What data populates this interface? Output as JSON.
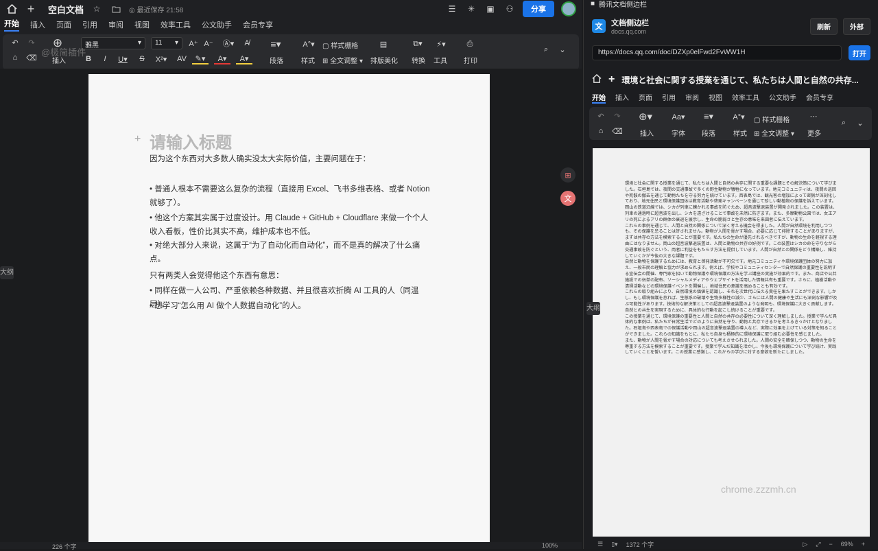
{
  "app": {
    "doc_title": "空白文档",
    "saved": "最近保存 21:58",
    "share": "分享",
    "menu": [
      "开始",
      "插入",
      "页面",
      "引用",
      "审阅",
      "视图",
      "效率工具",
      "公文助手",
      "会员专享"
    ],
    "toolbar": {
      "insert": "插入",
      "font": "雅黑",
      "size": "11",
      "paragraph": "段落",
      "style": "样式",
      "style_grid": "样式栅格",
      "full_adjust": "全文调整",
      "layout": "排版美化",
      "convert": "转换",
      "tools": "工具",
      "print": "打印"
    },
    "watermark": "@极简插件",
    "outline_tab": "大纲",
    "page": {
      "title_placeholder": "请输入标题",
      "p1": "因为这个东西对大多数人确实没太大实际价值，主要问题在于：",
      "b1": "• 普通人根本不需要这么复杂的流程（直接用 Excel、飞书多维表格、或者 Notion 就够了）。",
      "b2": "• 他这个方案其实属于过度设计。用 Claude + GitHub + Cloudflare 来做一个个人收入看板，性价比其实不高，维护成本也不低。",
      "b3": "• 对绝大部分人来说，这属于“为了自动化而自动化”，而不是真的解决了什么痛点。",
      "p2": "只有两类人会觉得他这个东西有意思：",
      "b4": "• 同样在做一人公司、严重依赖各种数据、并且很喜欢折腾 AI 工具的人（同温层）。",
      "b5": "• 想学习“怎么用 AI 做个人数据自动化”的人。"
    },
    "status": {
      "words": "226 个字",
      "zoom": "100%"
    }
  },
  "sidebar": {
    "window_title": "腾讯文档侧边栏",
    "ext_name": "文档侧边栏",
    "ext_domain": "docs.qq.com",
    "refresh": "刷新",
    "external": "外部",
    "url": "https://docs.qq.com/doc/DZXp0elFwd2FvWW1H",
    "open": "打开",
    "doc_title": "環境と社会に関する授業を通じて、私たちは人間と自然の共存...",
    "menu": [
      "开始",
      "插入",
      "页面",
      "引用",
      "审阅",
      "视图",
      "效率工具",
      "公文助手",
      "会员专享"
    ],
    "toolbar": {
      "insert": "插入",
      "font": "字体",
      "paragraph": "段落",
      "style": "样式",
      "style_grid": "样式栅格",
      "full_adjust": "全文调整",
      "more": "更多"
    },
    "outline_tab": "大纲",
    "paragraphs": [
      "環境と社会に関する授業を通じて、私たちは人間と自然の共存に関する重要な課題とその解決策について学びました。石垣島では、夜間の交通事故で多くの野生動物が犠牲になっています。地元コミュニティは、夜間の巡回や死骸の撤去を通じて動物たちを守る努力を続けています。西表島では、観光客の増加によって密猟が深刻化しており、地元住民と環境保護団体は教育活動や啓発キャンペーンを通じて珍しい動植物の保護を訴えています。岡山の鉄道沿線では、シカが列車に轢かれる事故を防ぐため、超音波撃退装置が開発されました。この装置は、列車の通過時に超音波を出し、シカを遠ざけることで事故を未然に防ぎます。また、多摩動物公園では、女王アリの死によるアリの群体の衰退を展示し、生命の脆弱さと生存の意味を来園者に伝えています。",
      "これらの事例を通じて、人間と自然の関係について深く考える機会を得ました。人間が自然環境を利用しつつも、その保護を怠ることは許されません。動物が人間を脅かす場合、必要に応じて排除することがありますが、まずは共存の方法を模索することが重要です。私たちの生命が優先されるべきですが、動物の生命を軽視する理由にはなりません。岡山の超音波撃退装置は、人間と動物の共存の好例です。この装置はシカの命を守りながら交通事故を防ぐという、両者に利益をもたらす方法を提供しています。人間が自然との関係をどう構築し、維持していくかが今後の大きな課題です。",
      "自然と動物を保護するためには、教育と啓発活動が不可欠です。地元コミュニティや環境保護団体の努力に加え、一般市民の理解と協力が求められます。例えば、学校やコミュニティセンターで自然保護の重要性を説明する宣伝会の開催、専門家を招いて動物保護や環境保護の方法を学ぶ講座の実施が効果的です。また、商店や公共施設での伝単の配布、ソーシャルメディアやウェブサイトを活用した情報共有も重要です。さらに、植樹活動や清掃活動などの環境保護イベントを開催し、地域住民の意識を高めることも有効です。",
      "これらの取り組みにより、自然環境の価値を認識し、それを次世代に伝える責任を果たすことができます。しかし、もし環境保護を怠れば、生態系の破壊や生物多様性の減少、さらには人間の健康や生活にも深刻な影響が及ぶ可能性があります。技術的な解決策としての超音波撃退装置のような発明も、環境保護に大きく貢献します。自然との共生を実現するために、具体的な行動を起こし続けることが重要です。",
      "この授業を通じて、環境保護の重要性と人間と自然の共存の必要性について深く理解しました。授業で学んだ具体的な事例は、私たちが日常生活でどのように自然を守り、動物と共存できるかを考えるきっかけとなりました。石垣島や西表島での保護活動や岡山の超音波撃退装置の導入など、実際に効果を上げている対策を知ることができました。これらの知識をもとに、私たち自身も積極的に環境保護に取り組む必要性を感じました。",
      "また、動物が人間を脅かす場合の対応についても考えさせられました。人間の安全を確保しつつ、動物の生命を尊重する方法を模索することが重要です。授業で学んだ知識を活かし、今後も環境保護について学び続け、実践していくことを誓います。この授業に感謝し、これからの学びに対する意欲を新たにしました。"
    ],
    "watermark": "chrome.zzzmh.cn",
    "status": {
      "words": "1372 个字",
      "zoom": "69%"
    }
  }
}
